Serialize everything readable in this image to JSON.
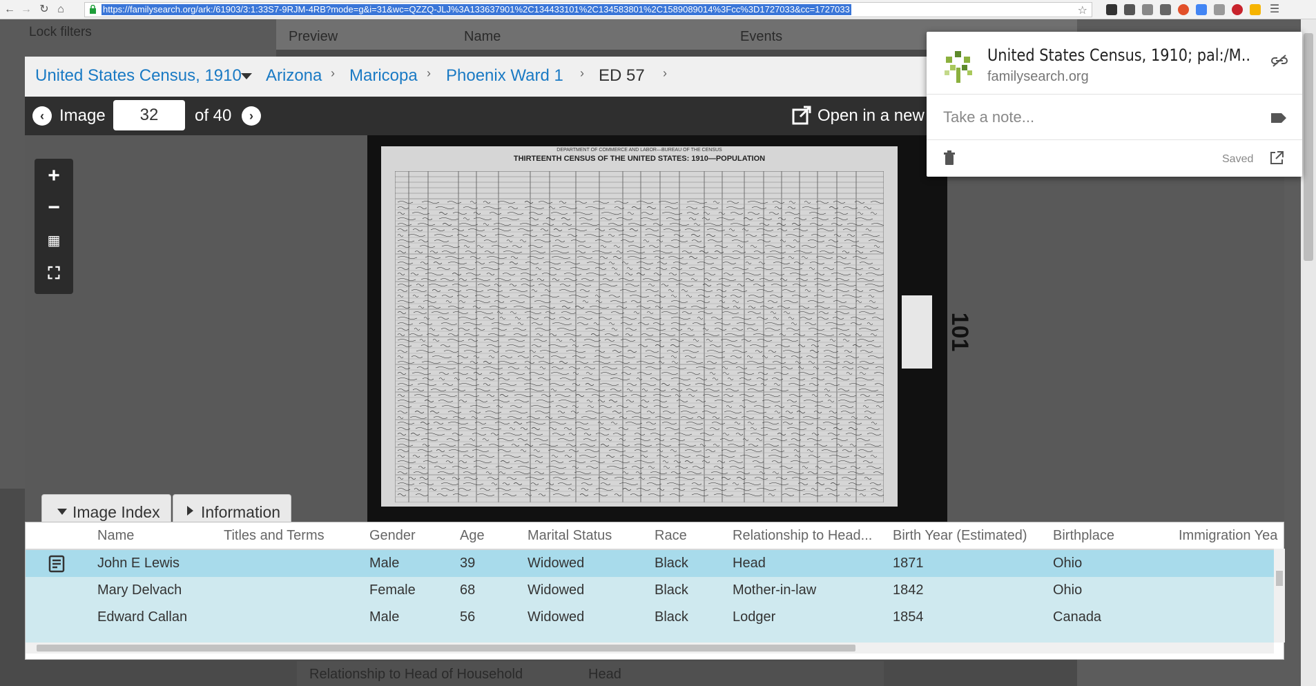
{
  "browser": {
    "url": "https://familysearch.org/ark:/61903/3:1:33S7-9RJM-4RB?mode=g&i=31&wc=QZZQ-JLJ%3A133637901%2C134433101%2C134583801%2C1589089014%3Fcc%3D1727033&cc=1727033"
  },
  "background": {
    "lock_filters": "Lock filters",
    "col_preview": "Preview",
    "col_name": "Name",
    "col_events": "Events",
    "bottom_label": "Relationship to Head of Household",
    "bottom_value": "Head"
  },
  "breadcrumb": {
    "collection": "United States Census, 1910",
    "state": "Arizona",
    "county": "Maricopa",
    "ward": "Phoenix Ward 1",
    "district": "ED 57"
  },
  "image_bar": {
    "image_label": "Image",
    "current_image": "32",
    "of_label": "of 40",
    "open_new": "Open in a new"
  },
  "document": {
    "header_top": "DEPARTMENT OF COMMERCE AND LABOR—BUREAU OF THE CENSUS",
    "header_title": "THIRTEENTH CENSUS OF THE UNITED STATES: 1910—POPULATION",
    "page_stamp": "101"
  },
  "tabs": {
    "image_index": "Image Index",
    "information": "Information"
  },
  "index_table": {
    "columns": [
      "Name",
      "Titles and Terms",
      "Gender",
      "Age",
      "Marital Status",
      "Race",
      "Relationship to Head...",
      "Birth Year (Estimated)",
      "Birthplace",
      "Immigration Yea"
    ],
    "rows": [
      [
        "John E Lewis",
        "",
        "Male",
        "39",
        "Widowed",
        "Black",
        "Head",
        "1871",
        "Ohio"
      ],
      [
        "Mary Delvach",
        "",
        "Female",
        "68",
        "Widowed",
        "Black",
        "Mother-in-law",
        "1842",
        "Ohio"
      ],
      [
        "Edward Callan",
        "",
        "Male",
        "56",
        "Widowed",
        "Black",
        "Lodger",
        "1854",
        "Canada"
      ]
    ],
    "selected_color": "#a8dbeb",
    "row_color": "#cfe9ef"
  },
  "keep_popup": {
    "title": "United States Census, 1910; pal:/M..",
    "domain": "familysearch.org",
    "note_placeholder": "Take a note...",
    "saved_label": "Saved"
  },
  "colors": {
    "link": "#1a7ac4",
    "toolbar": "#2f2f2f"
  }
}
